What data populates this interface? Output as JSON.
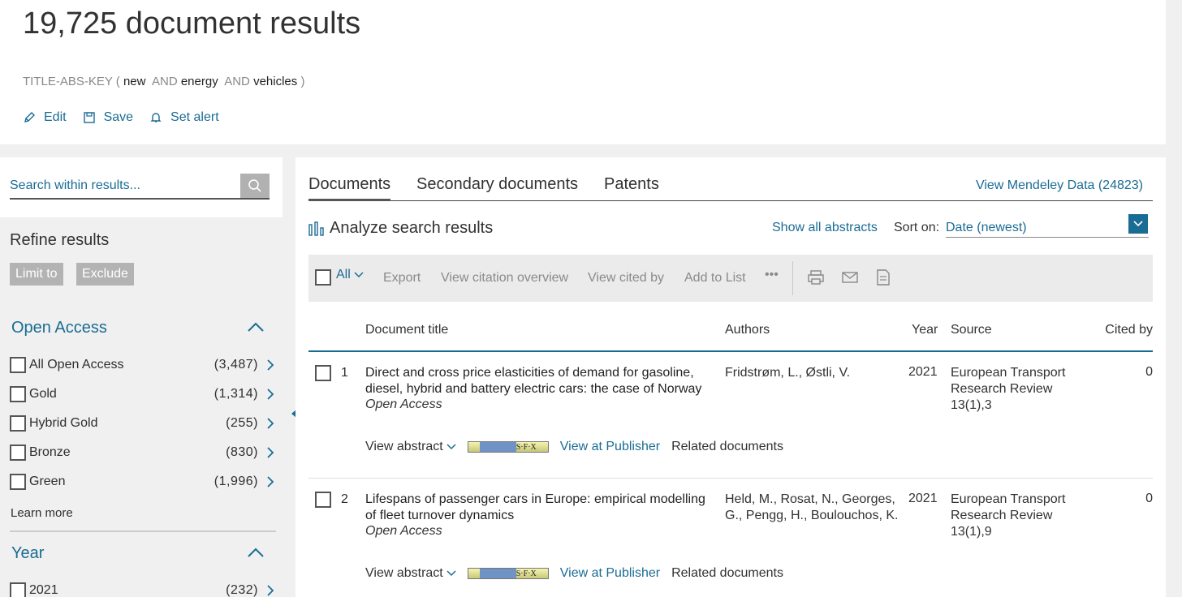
{
  "header": {
    "results_title": "19,725 document results",
    "query": {
      "field": "TITLE-ABS-KEY",
      "open": "(",
      "term1": "new",
      "op1": "AND",
      "term2": "energy",
      "op2": "AND",
      "term3": "vehicles",
      "close": ")"
    },
    "actions": {
      "edit": "Edit",
      "save": "Save",
      "set_alert": "Set alert"
    }
  },
  "sidebar": {
    "search_placeholder": "Search within results...",
    "refine_title": "Refine results",
    "limit_to": "Limit to",
    "exclude": "Exclude",
    "open_access": {
      "title": "Open Access",
      "items": [
        {
          "label": "All Open Access",
          "count": "(3,487)"
        },
        {
          "label": "Gold",
          "count": "(1,314)"
        },
        {
          "label": "Hybrid Gold",
          "count": "(255)"
        },
        {
          "label": "Bronze",
          "count": "(830)"
        },
        {
          "label": "Green",
          "count": "(1,996)"
        }
      ],
      "learn_more": "Learn more"
    },
    "year": {
      "title": "Year",
      "items": [
        {
          "label": "2021",
          "count": "(232)"
        }
      ]
    }
  },
  "main": {
    "tabs": [
      "Documents",
      "Secondary documents",
      "Patents"
    ],
    "mendeley": "View Mendeley Data (24823)",
    "analyze": "Analyze search results",
    "show_all_abstracts": "Show all abstracts",
    "sort_label": "Sort on:",
    "sort_value": "Date (newest)",
    "toolbar": {
      "all": "All",
      "export": "Export",
      "citation_overview": "View citation overview",
      "cited_by": "View cited by",
      "add_to_list": "Add to List",
      "more": "•••"
    },
    "columns": {
      "title": "Document title",
      "authors": "Authors",
      "year": "Year",
      "source": "Source",
      "cited_by": "Cited by"
    },
    "rows": [
      {
        "num": "1",
        "title": "Direct and cross price elasticities of demand for gasoline, diesel, hybrid and battery electric cars: the case of Norway",
        "access": "Open Access",
        "authors": "Fridstrøm, L., Østli, V.",
        "year": "2021",
        "source": "European Transport Research Review 13(1),3",
        "cited": "0",
        "view_abstract": "View abstract",
        "sfx": "S·F·X",
        "view_publisher": "View at Publisher",
        "related": "Related documents"
      },
      {
        "num": "2",
        "title": "Lifespans of passenger cars in Europe: empirical modelling of fleet turnover dynamics",
        "access": "Open Access",
        "authors": "Held, M., Rosat, N., Georges, G., Pengg, H., Boulouchos, K.",
        "year": "2021",
        "source": "European Transport Research Review 13(1),9",
        "cited": "0",
        "view_abstract": "View abstract",
        "sfx": "S·F·X",
        "view_publisher": "View at Publisher",
        "related": "Related documents"
      }
    ]
  },
  "colors": {
    "link": "#1a6c94",
    "pill": "#b3b3b3",
    "toolbar_bg": "#ebebeb"
  }
}
